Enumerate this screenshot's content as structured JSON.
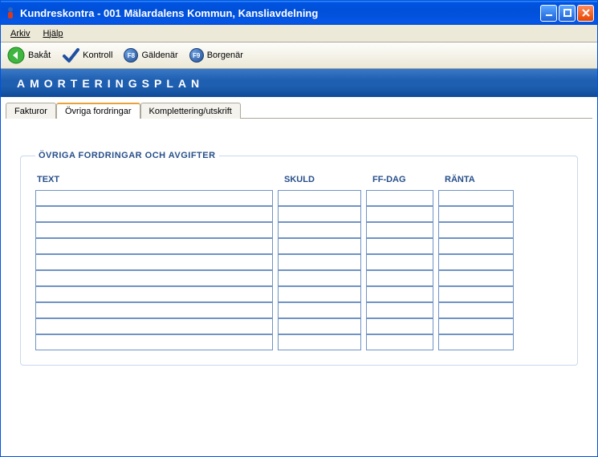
{
  "window": {
    "title": "Kundreskontra  -  001 Mälardalens Kommun, Kansliavdelning"
  },
  "menu": {
    "arkiv": "Arkiv",
    "hjalp": "Hjälp"
  },
  "toolbar": {
    "back": "Bakåt",
    "kontroll": "Kontroll",
    "galdenar_key": "F8",
    "galdenar": "Gäldenär",
    "borgenar_key": "F9",
    "borgenar": "Borgenär"
  },
  "heading": "AMORTERINGSPLAN",
  "tabs": {
    "fakturor": "Fakturor",
    "ovriga": "Övriga fordringar",
    "komplettering": "Komplettering/utskrift"
  },
  "group": {
    "legend": "ÖVRIGA FORDRINGAR OCH AVGIFTER",
    "columns": {
      "text": "TEXT",
      "skuld": "SKULD",
      "ffdag": "FF-DAG",
      "ranta": "RÄNTA"
    },
    "rows": [
      {
        "text": "",
        "skuld": "",
        "ffdag": "",
        "ranta": ""
      },
      {
        "text": "",
        "skuld": "",
        "ffdag": "",
        "ranta": ""
      },
      {
        "text": "",
        "skuld": "",
        "ffdag": "",
        "ranta": ""
      },
      {
        "text": "",
        "skuld": "",
        "ffdag": "",
        "ranta": ""
      },
      {
        "text": "",
        "skuld": "",
        "ffdag": "",
        "ranta": ""
      },
      {
        "text": "",
        "skuld": "",
        "ffdag": "",
        "ranta": ""
      },
      {
        "text": "",
        "skuld": "",
        "ffdag": "",
        "ranta": ""
      },
      {
        "text": "",
        "skuld": "",
        "ffdag": "",
        "ranta": ""
      },
      {
        "text": "",
        "skuld": "",
        "ffdag": "",
        "ranta": ""
      },
      {
        "text": "",
        "skuld": "",
        "ffdag": "",
        "ranta": ""
      }
    ]
  }
}
